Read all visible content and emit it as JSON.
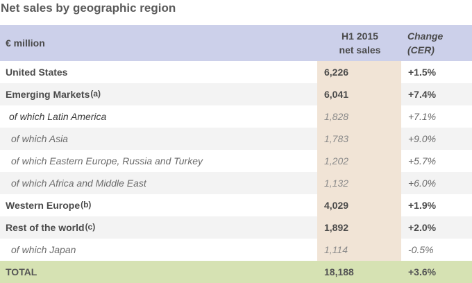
{
  "title": "Net sales by geographic region",
  "table": {
    "header": {
      "region": "€ million",
      "sales_line1": "H1 2015",
      "sales_line2": "net sales",
      "change_line1": "Change",
      "change_line2": "(CER)"
    },
    "rows": [
      {
        "region": "United States",
        "note": "",
        "sales": "6,226",
        "change": "+1.5%"
      },
      {
        "region": "Emerging Markets",
        "note": "(a)",
        "sales": "6,041",
        "change": "+7.4%"
      },
      {
        "region": "of which Latin America",
        "sales": "1,828",
        "change": "+7.1%"
      },
      {
        "region": "of which Asia",
        "sales": "1,783",
        "change": "+9.0%"
      },
      {
        "region": "of which Eastern Europe, Russia and Turkey",
        "sales": "1,202",
        "change": "+5.7%"
      },
      {
        "region": "of which Africa and Middle East",
        "sales": "1,132",
        "change": "+6.0%"
      },
      {
        "region": "Western Europe",
        "note": "(b)",
        "sales": "4,029",
        "change": "+1.9%"
      },
      {
        "region": "Rest of the world",
        "note": "(c)",
        "sales": "1,892",
        "change": "+2.0%"
      },
      {
        "region": "of which Japan",
        "sales": "1,114",
        "change": "-0.5%"
      }
    ],
    "total": {
      "region": "TOTAL",
      "sales": "18,188",
      "change": "+3.6%"
    }
  }
}
